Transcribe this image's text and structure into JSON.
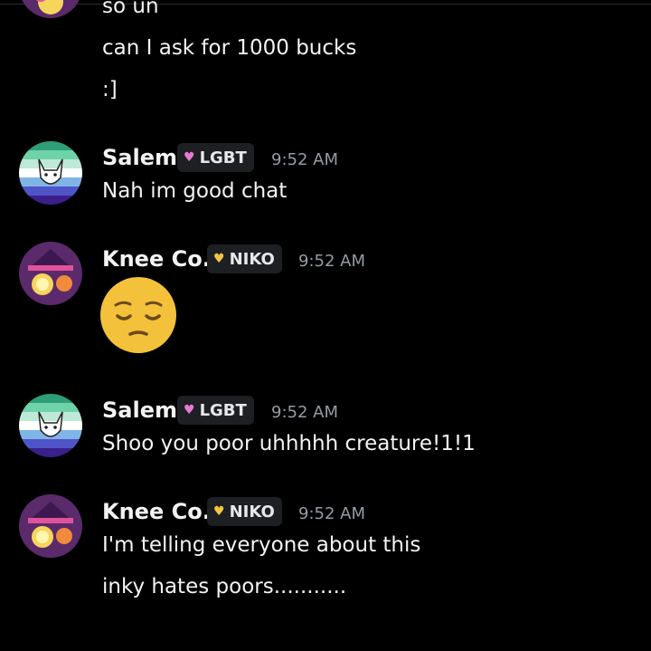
{
  "messages": [
    {
      "lines": [
        "so un",
        "can I ask for 1000 bucks",
        ":]"
      ]
    },
    {
      "author": "Salem",
      "tag": "LGBT",
      "time": "9:52 AM",
      "lines": [
        "Nah im good chat"
      ]
    },
    {
      "author": "Knee Co.",
      "tag": "NIKO",
      "time": "9:52 AM",
      "emoji": "pensive-face"
    },
    {
      "author": "Salem",
      "tag": "LGBT",
      "time": "9:52 AM",
      "lines": [
        "Shoo you poor uhhhhh creature!1!1"
      ]
    },
    {
      "author": "Knee Co.",
      "tag": "NIKO",
      "time": "9:52 AM",
      "lines": [
        "I'm telling everyone about this",
        "inky hates poors..........."
      ]
    }
  ],
  "icons": {
    "lgbt_tag": "pink-heart-icon",
    "niko_tag": "gold-heart-icon"
  },
  "colors": {
    "background": "#000000",
    "username": "#f2f3f5",
    "timestamp": "#949ba4",
    "tag_bg": "#1e1f22"
  }
}
